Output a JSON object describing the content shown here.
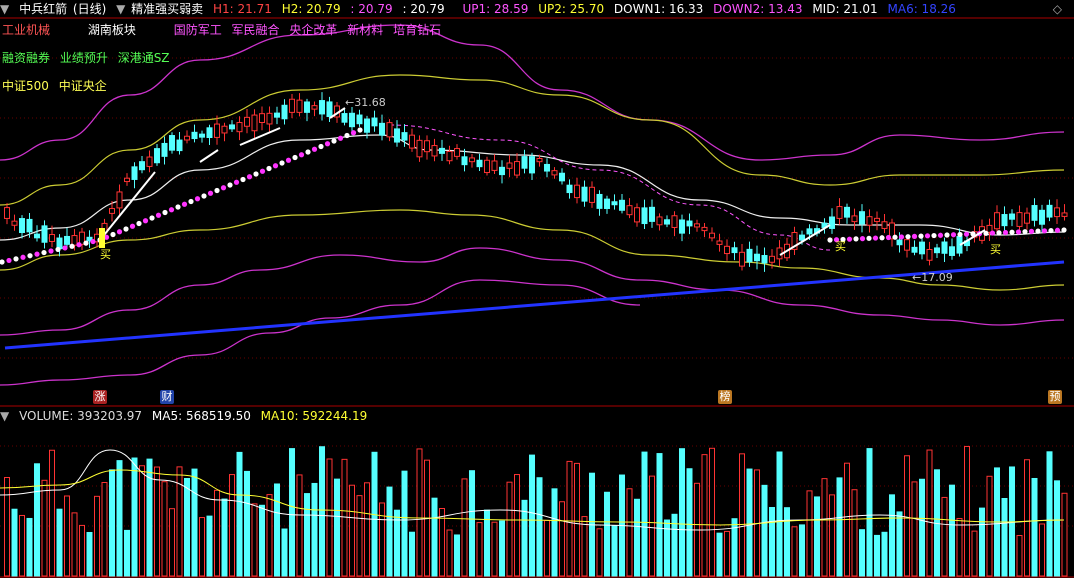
{
  "header": {
    "stock_name": "中兵红箭",
    "period": "(日线)",
    "indicator_name": "精准强买弱卖",
    "h1_label": "H1: 21.71",
    "h2_label": "H2: 20.79",
    "h2_extra": ": 20.79",
    "h2_extra2": ": 20.79",
    "up1_label": "UP1: 28.59",
    "up2_label": "UP2: 25.70",
    "down1_label": "DOWN1: 16.33",
    "down2_label": "DOWN2: 13.43",
    "mid_label": "MID: 21.01",
    "ma6_label": "MA6: 18.26",
    "colors": {
      "h1": "#ff4444",
      "h2": "#ffff33",
      "up1": "#ff55ff",
      "up2": "#ffff33",
      "down1": "#ffffff",
      "down2": "#ff55ff",
      "mid": "#ffffff",
      "ma6": "#3344ff"
    }
  },
  "tags": {
    "row1": [
      "工业机械",
      "湖南板块",
      "国防军工",
      "军民融合",
      "央企改革",
      "新材料",
      "培育钻石"
    ],
    "row2": [
      "融资融券",
      "业绩预升",
      "深港通SZ"
    ],
    "row3": [
      "中证500",
      "中证央企"
    ],
    "row1_colors": [
      "#ff5555",
      "#ffffff",
      "#ff55ff",
      "#ff55ff",
      "#ff55ff",
      "#ff55ff",
      "#ff55ff"
    ],
    "row2_color": "#55ff55",
    "row3_color": "#ffff55"
  },
  "annotations": {
    "high_price": "31.68",
    "low_price": "17.09",
    "buy_label": "买",
    "sell_label": "卖"
  },
  "markers": [
    {
      "text": "涨",
      "bg": "#aa2222"
    },
    {
      "text": "财",
      "bg": "#2244aa"
    },
    {
      "text": "榜",
      "bg": "#bb7722"
    },
    {
      "text": "预",
      "bg": "#bb7722"
    }
  ],
  "volume": {
    "label": "VOLUME: 393203.97",
    "ma5_label": "MA5: 568519.50",
    "ma10_label": "MA10: 592244.19",
    "colors": {
      "volume": "#dddddd",
      "ma5": "#ffffff",
      "ma10": "#ffff33"
    }
  },
  "colors": {
    "up": "#ff3333",
    "down": "#55ffff",
    "grid": "#880000",
    "ma_long": "#2233ff"
  }
}
